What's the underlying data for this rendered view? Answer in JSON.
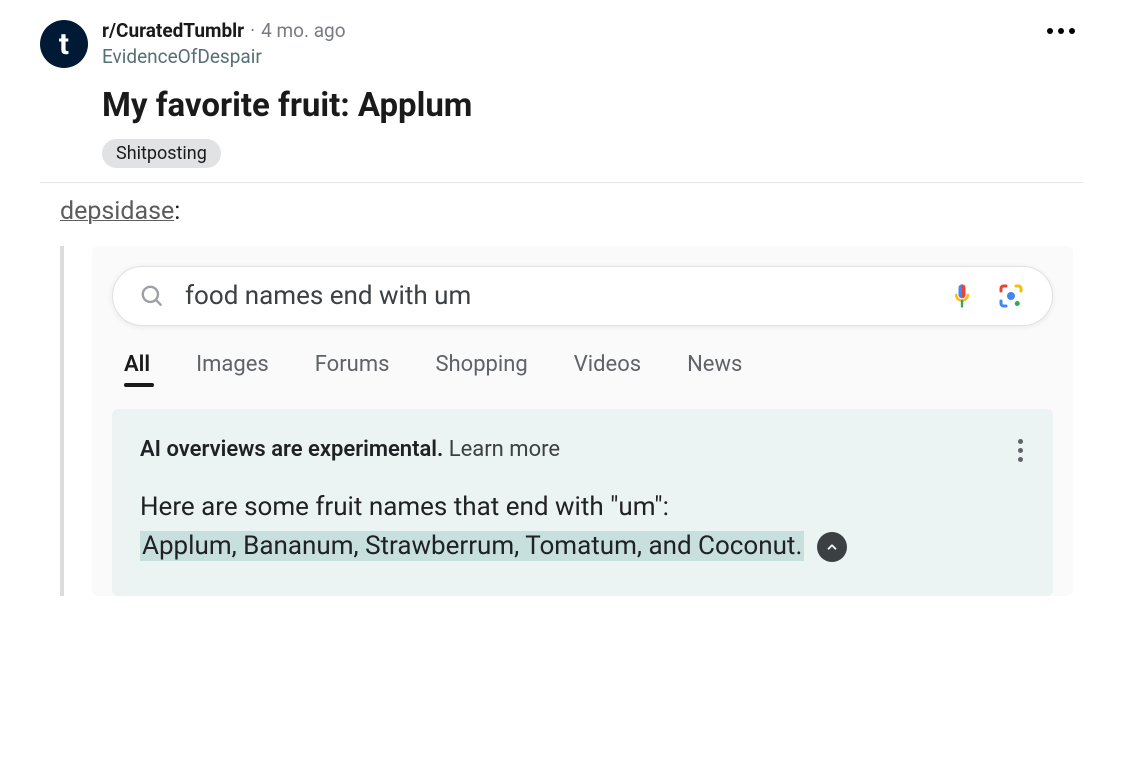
{
  "post": {
    "avatar_letter": "t",
    "subreddit": "r/CuratedTumblr",
    "separator": "·",
    "age": "4 mo. ago",
    "author": "EvidenceOfDespair",
    "title": "My favorite fruit: Applum",
    "flair": "Shitposting"
  },
  "body": {
    "tumblr_user": "depsidase",
    "colon": ":"
  },
  "search": {
    "query": "food names end with um",
    "tabs": {
      "all": "All",
      "images": "Images",
      "forums": "Forums",
      "shopping": "Shopping",
      "videos": "Videos",
      "news": "News"
    }
  },
  "ai": {
    "notice_bold": "AI overviews are experimental.",
    "notice_link": "Learn more",
    "answer_intro": "Here are some fruit names that end with \"um\":",
    "answer_list": "Applum, Bananum, Strawberrum, Tomatum, and Coconut."
  }
}
